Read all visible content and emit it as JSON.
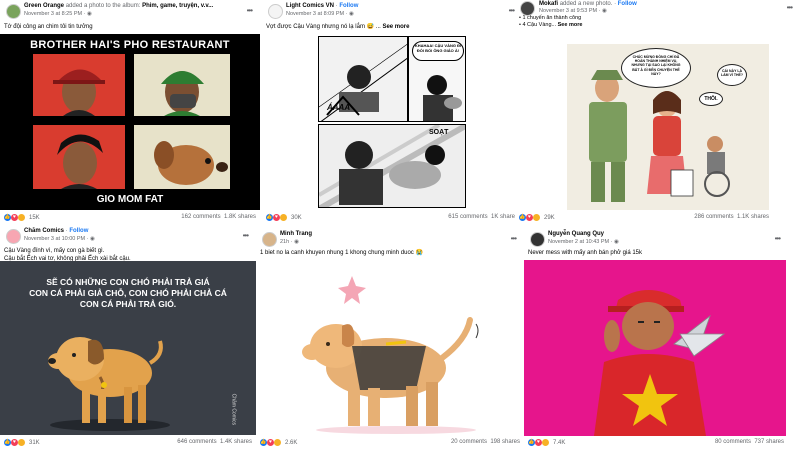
{
  "posts": [
    {
      "author": "Green Orange",
      "action": "added a photo to the album:",
      "album": "Phim, game, truyện, v.v...",
      "time": "November 3 at 8:25 PM",
      "caption": "Tớ đội công an chim tôi tin tưởng",
      "image_title": "BROTHER HAI'S PHO RESTAURANT",
      "image_footer": "GIO MOM FAT",
      "reactions": "15K",
      "comments": "162 comments",
      "shares": "1.8K shares"
    },
    {
      "author": "Light Comics VN",
      "follow": "Follow",
      "time": "November 3 at 8:09 PM",
      "caption": "Vợt được Cậu Vàng nhưng nó lạ lắm",
      "see_more": "See more",
      "bubble1": "KHAHAA! CẬU VÀNG ĐI ĐÓI BỐI ÔNG GIÁO À!",
      "bubble2": "SOẠT",
      "sfx": "ÁAAA",
      "reactions": "30K",
      "comments": "615 comments",
      "shares": "1K shares"
    },
    {
      "author": "Mokafi",
      "action": "added a new photo.",
      "follow": "Follow",
      "time": "November 3 at 9:53 PM",
      "caption_line1": "1 chuyến ăn thành công",
      "caption_line2": "4 Cậu Vàng...",
      "see_more": "See more",
      "bubble1": "CHÚC MỪNG ĐỒNG CHÍ ĐÃ HOÀN THÀNH NHIỆM VỤ, NHƯNG TẠI SAO LẠI KHÔNG BẮT Ả GÌ ĐẾN CHUYỆN THẾ NÀY?",
      "bubble2": "CÁI NÀY LÀ LÀM VÌ THẾ?",
      "bubble3": "THÔI.",
      "reactions": "29K",
      "comments": "286 comments",
      "shares": "1.1K shares"
    },
    {
      "author": "Chăm Comics",
      "follow": "Follow",
      "time": "November 3 at 10:00 PM",
      "caption_line1": "Cậu Vàng đính vì, mấy con gà biết gì.",
      "caption_line2": "Cậu bắt Ếch vai tơ, không phải Ếch xài bắt cậu.",
      "image_text": "SẼ CÓ NHỮNG CON CHÓ PHẢI TRẢ GIÁ\nCON CÁ PHẢI GIẢ CHỖ, CON CHÓ PHẢI CHẢ CÁ\nCON CÁ PHẢI TRẢ GIÓ.",
      "watermark": "Chăm Comics",
      "reactions": "31K",
      "comments": "646 comments",
      "shares": "1.4K shares"
    },
    {
      "author": "Minh Trang",
      "time": "21h",
      "caption": "1 biet no la canh khuyen nhung 1 khong chung minh duoc",
      "reactions": "2.6K",
      "comments": "20 comments",
      "shares": "198 shares"
    },
    {
      "author": "Nguyễn Quang Quy",
      "time": "November 2 at 10:43 PM",
      "caption": "Never mess with mấy anh bán phở giá 15k",
      "reactions": "7.4K",
      "comments": "80 comments",
      "shares": "737 shares"
    }
  ],
  "colors": {
    "magenta": "#e6158c",
    "shirt": "#d9262a",
    "star": "#f1c40f",
    "dog": "#e2a24c",
    "dark_bg": "#2b2f36"
  }
}
